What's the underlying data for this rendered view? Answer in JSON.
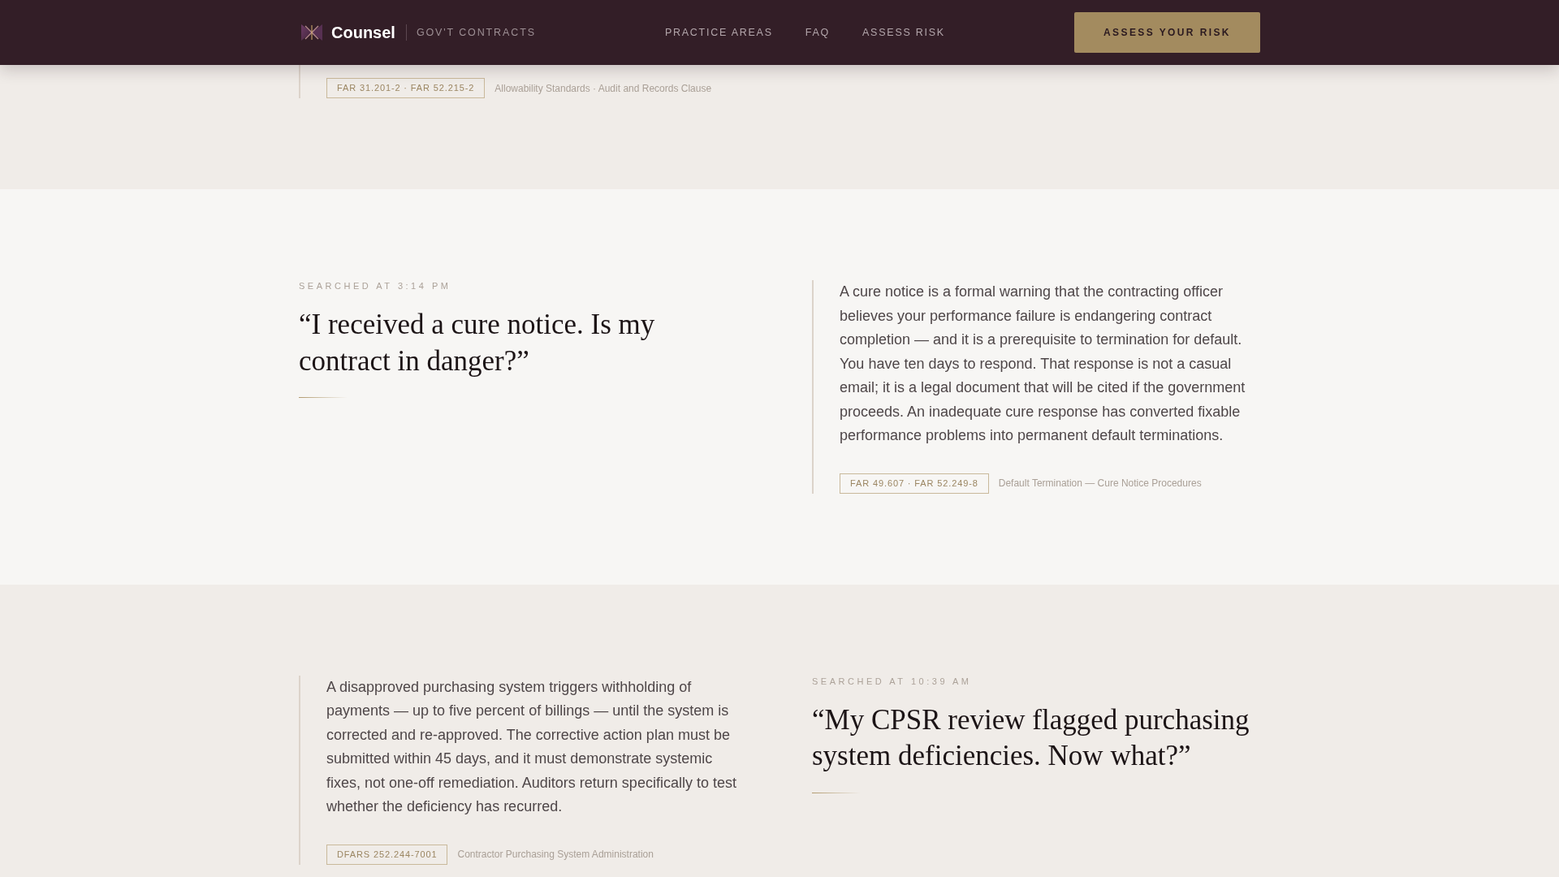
{
  "nav": {
    "brand": "Counsel",
    "tagline": "GOV'T CONTRACTS",
    "links": [
      "PRACTICE AREAS",
      "FAQ",
      "ASSESS RISK"
    ],
    "cta": "ASSESS YOUR RISK"
  },
  "entries": [
    {
      "kind": "answer-first",
      "citation": "FAR 31.201-2 · FAR 52.215-2",
      "topic": "Allowability Standards · Audit and Records Clause"
    },
    {
      "kind": "question-first",
      "searched_at": "SEARCHED AT 3:14 PM",
      "question": "“I received a cure notice. Is my contract in danger?”",
      "answer": "A cure notice is a formal warning that the contracting officer believes your performance failure is endangering contract completion — and it is a prerequisite to termination for default. You have ten days to respond. That response is not a casual email; it is a legal document that will be cited if the government proceeds. An inadequate cure response has converted fixable performance problems into permanent default terminations.",
      "citation": "FAR 49.607 · FAR 52.249-8",
      "topic": "Default Termination — Cure Notice Procedures"
    },
    {
      "kind": "answer-first",
      "searched_at": "SEARCHED AT 10:39 AM",
      "question": "“My CPSR review flagged purchasing system deficiencies. Now what?”",
      "answer": "A disapproved purchasing system triggers withholding of payments — up to five percent of billings — until the system is corrected and re-approved. The corrective action plan must be submitted within 45 days, and it must demonstrate systemic fixes, not one-off remediation. Auditors return specifically to test whether the deficiency has recurred.",
      "citation": "DFARS 252.244-7001",
      "topic": "Contractor Purchasing System Administration"
    }
  ]
}
